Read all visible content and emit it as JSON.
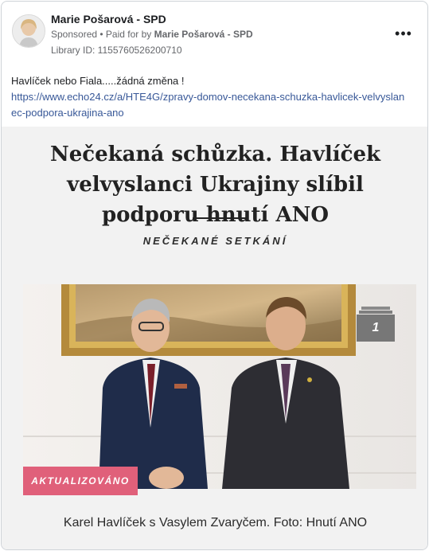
{
  "ad": {
    "page_name": "Marie Pošarová - SPD",
    "sponsored_label": "Sponsored",
    "separator": " • ",
    "paid_for_prefix": "Paid for by ",
    "paid_for_name": "Marie Pošarová - SPD",
    "library_id": "Library ID: 1155760526200710",
    "more_icon": "more-horizontal-icon"
  },
  "post": {
    "text": "Havlíček nebo Fiala.....žádná změna !",
    "link": "https://www.echo24.cz/a/HTE4G/zpravy-domov-necekana-schuzka-havlicek-velvyslanec-podpora-ukrajina-ano"
  },
  "creative": {
    "headline": "Nečekaná schůzka. Havlíček velvyslanci Ukrajiny slíbil podporu hnutí ANO",
    "kicker": "NEČEKANÉ SETKÁNÍ",
    "photo_counter": "1",
    "update_badge": "AKTUALIZOVÁNO",
    "caption": "Karel Havlíček s Vasylem Zvaryčem. Foto: Hnutí ANO"
  },
  "colors": {
    "link": "#385898",
    "badge_pink": "#e0607a",
    "text_dark": "#1c1e21",
    "meta_gray": "#65676b"
  }
}
